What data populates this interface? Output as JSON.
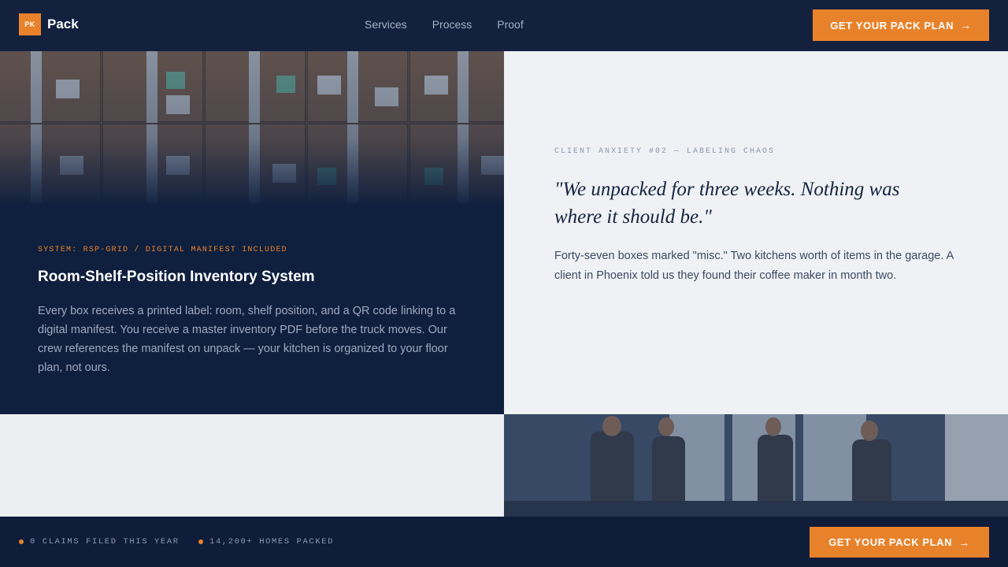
{
  "brand": {
    "mark": "PK",
    "name": "Pack"
  },
  "nav": {
    "items": [
      "Services",
      "Process",
      "Proof"
    ]
  },
  "header": {
    "cta_label": "GET YOUR PACK PLAN"
  },
  "feature": {
    "system_label": "SYSTEM: RSP-GRID / DIGITAL MANIFEST INCLUDED",
    "title": "Room-Shelf-Position Inventory System",
    "body": "Every box receives a printed label: room, shelf position, and a QR code linking to a digital manifest. You receive a master inventory PDF before the truck moves. Our crew references the manifest on unpack — your kitchen is organized to your floor plan, not ours."
  },
  "anxiety": {
    "label": "CLIENT ANXIETY #02 — LABELING CHAOS",
    "quote": "\"We unpacked for three weeks. Nothing was where it should be.\"",
    "body": "Forty-seven boxes marked \"misc.\" Two kitchens worth of items in the garage. A client in Phoenix told us they found their coffee maker in month two."
  },
  "footer": {
    "stats": [
      "0 CLAIMS FILED THIS YEAR",
      "14,200+ HOMES PACKED"
    ],
    "cta_label": "GET YOUR PACK PLAN"
  },
  "icons": {
    "cta_arrow": "arrow-right-icon",
    "stat_bullet": "dot-icon"
  },
  "colors": {
    "accent": "#e8822a",
    "navy": "#0f1f3e",
    "light": "#eff1f4"
  }
}
